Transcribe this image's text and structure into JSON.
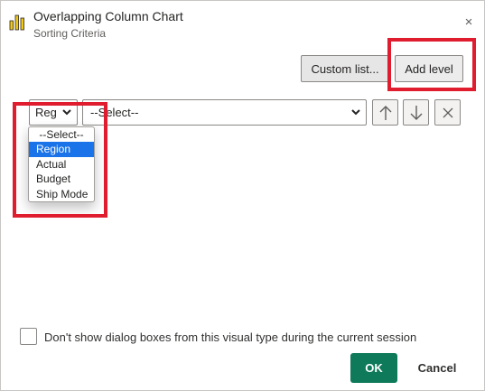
{
  "header": {
    "title": "Overlapping Column Chart",
    "subtitle": "Sorting Criteria",
    "close_glyph": "×"
  },
  "toolbar": {
    "custom_list_label": "Custom list...",
    "add_level_label": "Add level"
  },
  "sort_row": {
    "column_select_value": "Reg",
    "order_select_value": "--Select--"
  },
  "dropdown": {
    "options": [
      "--Select--",
      "Region",
      "Actual",
      "Budget",
      "Ship Mode"
    ],
    "selected": "Region"
  },
  "footer": {
    "checkbox_label": "Don't show dialog boxes from this visual type during the current session",
    "checkbox_checked": false,
    "ok_label": "OK",
    "cancel_label": "Cancel"
  },
  "colors": {
    "highlight": "#e01d2e",
    "primary": "#0f7a5a",
    "selection": "#1a73e8",
    "chart_icon_yellow": "#f2c811"
  },
  "icons": [
    "bar-chart-icon",
    "close-icon",
    "chevron-down-icon",
    "arrow-up-icon",
    "arrow-down-icon",
    "delete-icon"
  ]
}
